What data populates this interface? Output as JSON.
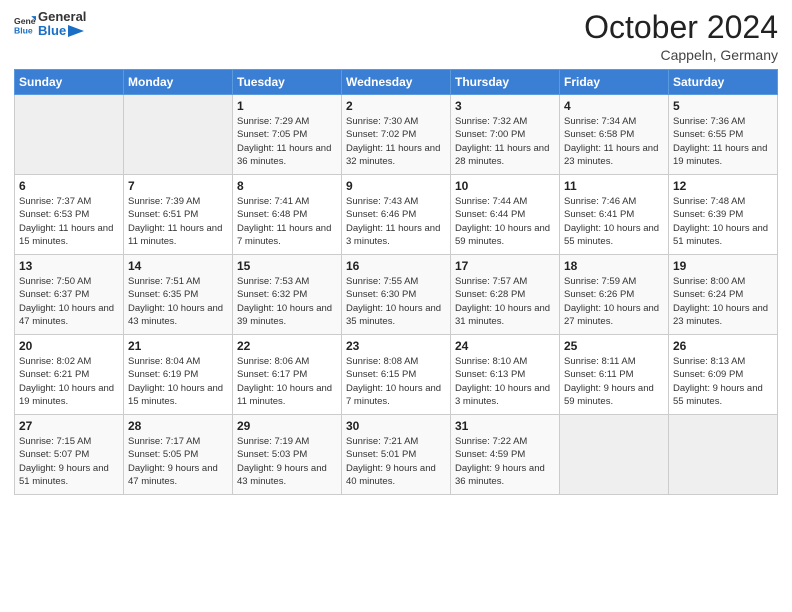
{
  "header": {
    "logo_line1": "General",
    "logo_line2": "Blue",
    "month": "October 2024",
    "location": "Cappeln, Germany"
  },
  "days_of_week": [
    "Sunday",
    "Monday",
    "Tuesday",
    "Wednesday",
    "Thursday",
    "Friday",
    "Saturday"
  ],
  "weeks": [
    [
      {
        "day": "",
        "empty": true
      },
      {
        "day": "",
        "empty": true
      },
      {
        "day": "1",
        "sunrise": "Sunrise: 7:29 AM",
        "sunset": "Sunset: 7:05 PM",
        "daylight": "Daylight: 11 hours and 36 minutes."
      },
      {
        "day": "2",
        "sunrise": "Sunrise: 7:30 AM",
        "sunset": "Sunset: 7:02 PM",
        "daylight": "Daylight: 11 hours and 32 minutes."
      },
      {
        "day": "3",
        "sunrise": "Sunrise: 7:32 AM",
        "sunset": "Sunset: 7:00 PM",
        "daylight": "Daylight: 11 hours and 28 minutes."
      },
      {
        "day": "4",
        "sunrise": "Sunrise: 7:34 AM",
        "sunset": "Sunset: 6:58 PM",
        "daylight": "Daylight: 11 hours and 23 minutes."
      },
      {
        "day": "5",
        "sunrise": "Sunrise: 7:36 AM",
        "sunset": "Sunset: 6:55 PM",
        "daylight": "Daylight: 11 hours and 19 minutes."
      }
    ],
    [
      {
        "day": "6",
        "sunrise": "Sunrise: 7:37 AM",
        "sunset": "Sunset: 6:53 PM",
        "daylight": "Daylight: 11 hours and 15 minutes."
      },
      {
        "day": "7",
        "sunrise": "Sunrise: 7:39 AM",
        "sunset": "Sunset: 6:51 PM",
        "daylight": "Daylight: 11 hours and 11 minutes."
      },
      {
        "day": "8",
        "sunrise": "Sunrise: 7:41 AM",
        "sunset": "Sunset: 6:48 PM",
        "daylight": "Daylight: 11 hours and 7 minutes."
      },
      {
        "day": "9",
        "sunrise": "Sunrise: 7:43 AM",
        "sunset": "Sunset: 6:46 PM",
        "daylight": "Daylight: 11 hours and 3 minutes."
      },
      {
        "day": "10",
        "sunrise": "Sunrise: 7:44 AM",
        "sunset": "Sunset: 6:44 PM",
        "daylight": "Daylight: 10 hours and 59 minutes."
      },
      {
        "day": "11",
        "sunrise": "Sunrise: 7:46 AM",
        "sunset": "Sunset: 6:41 PM",
        "daylight": "Daylight: 10 hours and 55 minutes."
      },
      {
        "day": "12",
        "sunrise": "Sunrise: 7:48 AM",
        "sunset": "Sunset: 6:39 PM",
        "daylight": "Daylight: 10 hours and 51 minutes."
      }
    ],
    [
      {
        "day": "13",
        "sunrise": "Sunrise: 7:50 AM",
        "sunset": "Sunset: 6:37 PM",
        "daylight": "Daylight: 10 hours and 47 minutes."
      },
      {
        "day": "14",
        "sunrise": "Sunrise: 7:51 AM",
        "sunset": "Sunset: 6:35 PM",
        "daylight": "Daylight: 10 hours and 43 minutes."
      },
      {
        "day": "15",
        "sunrise": "Sunrise: 7:53 AM",
        "sunset": "Sunset: 6:32 PM",
        "daylight": "Daylight: 10 hours and 39 minutes."
      },
      {
        "day": "16",
        "sunrise": "Sunrise: 7:55 AM",
        "sunset": "Sunset: 6:30 PM",
        "daylight": "Daylight: 10 hours and 35 minutes."
      },
      {
        "day": "17",
        "sunrise": "Sunrise: 7:57 AM",
        "sunset": "Sunset: 6:28 PM",
        "daylight": "Daylight: 10 hours and 31 minutes."
      },
      {
        "day": "18",
        "sunrise": "Sunrise: 7:59 AM",
        "sunset": "Sunset: 6:26 PM",
        "daylight": "Daylight: 10 hours and 27 minutes."
      },
      {
        "day": "19",
        "sunrise": "Sunrise: 8:00 AM",
        "sunset": "Sunset: 6:24 PM",
        "daylight": "Daylight: 10 hours and 23 minutes."
      }
    ],
    [
      {
        "day": "20",
        "sunrise": "Sunrise: 8:02 AM",
        "sunset": "Sunset: 6:21 PM",
        "daylight": "Daylight: 10 hours and 19 minutes."
      },
      {
        "day": "21",
        "sunrise": "Sunrise: 8:04 AM",
        "sunset": "Sunset: 6:19 PM",
        "daylight": "Daylight: 10 hours and 15 minutes."
      },
      {
        "day": "22",
        "sunrise": "Sunrise: 8:06 AM",
        "sunset": "Sunset: 6:17 PM",
        "daylight": "Daylight: 10 hours and 11 minutes."
      },
      {
        "day": "23",
        "sunrise": "Sunrise: 8:08 AM",
        "sunset": "Sunset: 6:15 PM",
        "daylight": "Daylight: 10 hours and 7 minutes."
      },
      {
        "day": "24",
        "sunrise": "Sunrise: 8:10 AM",
        "sunset": "Sunset: 6:13 PM",
        "daylight": "Daylight: 10 hours and 3 minutes."
      },
      {
        "day": "25",
        "sunrise": "Sunrise: 8:11 AM",
        "sunset": "Sunset: 6:11 PM",
        "daylight": "Daylight: 9 hours and 59 minutes."
      },
      {
        "day": "26",
        "sunrise": "Sunrise: 8:13 AM",
        "sunset": "Sunset: 6:09 PM",
        "daylight": "Daylight: 9 hours and 55 minutes."
      }
    ],
    [
      {
        "day": "27",
        "sunrise": "Sunrise: 7:15 AM",
        "sunset": "Sunset: 5:07 PM",
        "daylight": "Daylight: 9 hours and 51 minutes."
      },
      {
        "day": "28",
        "sunrise": "Sunrise: 7:17 AM",
        "sunset": "Sunset: 5:05 PM",
        "daylight": "Daylight: 9 hours and 47 minutes."
      },
      {
        "day": "29",
        "sunrise": "Sunrise: 7:19 AM",
        "sunset": "Sunset: 5:03 PM",
        "daylight": "Daylight: 9 hours and 43 minutes."
      },
      {
        "day": "30",
        "sunrise": "Sunrise: 7:21 AM",
        "sunset": "Sunset: 5:01 PM",
        "daylight": "Daylight: 9 hours and 40 minutes."
      },
      {
        "day": "31",
        "sunrise": "Sunrise: 7:22 AM",
        "sunset": "Sunset: 4:59 PM",
        "daylight": "Daylight: 9 hours and 36 minutes."
      },
      {
        "day": "",
        "empty": true
      },
      {
        "day": "",
        "empty": true
      }
    ]
  ]
}
